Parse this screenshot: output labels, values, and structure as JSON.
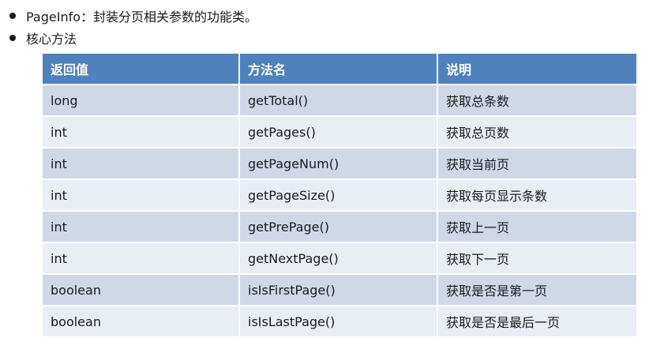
{
  "bullets": [
    "PageInfo：封装分页相关参数的功能类。",
    "核心方法"
  ],
  "table": {
    "headers": [
      "返回值",
      "方法名",
      "说明"
    ],
    "rows": [
      [
        "long",
        "getTotal()",
        "获取总条数"
      ],
      [
        "int",
        "getPages()",
        "获取总页数"
      ],
      [
        "int",
        "getPageNum()",
        "获取当前页"
      ],
      [
        "int",
        "getPageSize()",
        "获取每页显示条数"
      ],
      [
        "int",
        "getPrePage()",
        "获取上一页"
      ],
      [
        "int",
        "getNextPage()",
        "获取下一页"
      ],
      [
        "boolean",
        "isIsFirstPage()",
        "获取是否是第一页"
      ],
      [
        "boolean",
        "isIsLastPage()",
        "获取是否是最后一页"
      ]
    ]
  },
  "colors": {
    "header_bg": "#4f81bd",
    "row_odd_bg": "#d0d8e8",
    "row_even_bg": "#e9edf4"
  }
}
